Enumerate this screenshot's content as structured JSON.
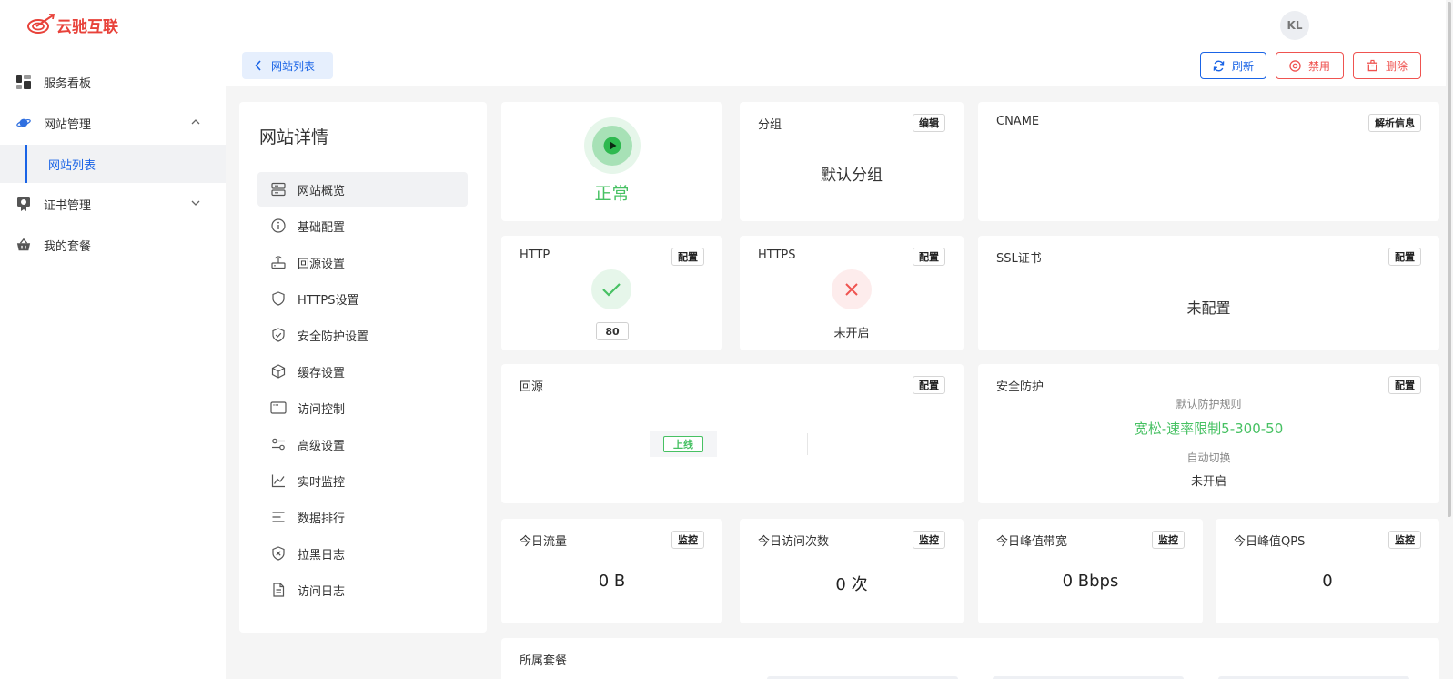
{
  "brand": {
    "name": "云驰互联",
    "color": "#e8423a"
  },
  "colors": {
    "primary": "#1a64e6",
    "danger": "#ef5350",
    "success": "#47c163"
  },
  "nav": {
    "dashboard": {
      "label": "服务看板",
      "icon": "dashboard-icon"
    },
    "site_mgmt": {
      "label": "网站管理",
      "icon": "planet-icon"
    },
    "site_list": {
      "label": "网站列表"
    },
    "cert_mgmt": {
      "label": "证书管理",
      "icon": "certificate-icon"
    },
    "my_plan": {
      "label": "我的套餐",
      "icon": "basket-icon"
    }
  },
  "header": {
    "avatar": "KL",
    "back_label": "网站列表",
    "refresh_label": "刷新",
    "disable_label": "禁用",
    "delete_label": "删除"
  },
  "detail": {
    "title": "网站详情",
    "menu": [
      {
        "label": "网站概览",
        "icon": "server-icon"
      },
      {
        "label": "基础配置",
        "icon": "info-icon"
      },
      {
        "label": "回源设置",
        "icon": "router-icon"
      },
      {
        "label": "HTTPS设置",
        "icon": "shield-icon"
      },
      {
        "label": "安全防护设置",
        "icon": "shield-check-icon"
      },
      {
        "label": "缓存设置",
        "icon": "cube-icon"
      },
      {
        "label": "访问控制",
        "icon": "window-icon"
      },
      {
        "label": "高级设置",
        "icon": "sliders-icon"
      },
      {
        "label": "实时监控",
        "icon": "chart-line-icon"
      },
      {
        "label": "数据排行",
        "icon": "list-icon"
      },
      {
        "label": "拉黑日志",
        "icon": "shield-x-icon"
      },
      {
        "label": "访问日志",
        "icon": "document-icon"
      }
    ]
  },
  "cards": {
    "status": {
      "text": "正常"
    },
    "group": {
      "label": "分组",
      "action": "编辑",
      "value": "默认分组"
    },
    "cname": {
      "label": "CNAME",
      "action": "解析信息",
      "value": ""
    },
    "http": {
      "label": "HTTP",
      "action": "配置",
      "port": "80"
    },
    "https": {
      "label": "HTTPS",
      "action": "配置",
      "status": "未开启"
    },
    "ssl": {
      "label": "SSL证书",
      "action": "配置",
      "status": "未配置"
    },
    "origin": {
      "label": "回源",
      "action": "配置",
      "badge": "上线"
    },
    "security": {
      "label": "安全防护",
      "action": "配置",
      "rule_caption": "默认防护规则",
      "rule_name": "宽松-速率限制5-300-50",
      "auto_caption": "自动切换",
      "auto_status": "未开启"
    },
    "traffic": {
      "label": "今日流量",
      "action": "监控",
      "value": "0 B"
    },
    "visits": {
      "label": "今日访问次数",
      "action": "监控",
      "value": "0 次"
    },
    "bandwidth": {
      "label": "今日峰值带宽",
      "action": "监控",
      "value": "0 Bbps"
    },
    "qps": {
      "label": "今日峰值QPS",
      "action": "监控",
      "value": "0"
    },
    "plan": {
      "label": "所属套餐"
    }
  }
}
